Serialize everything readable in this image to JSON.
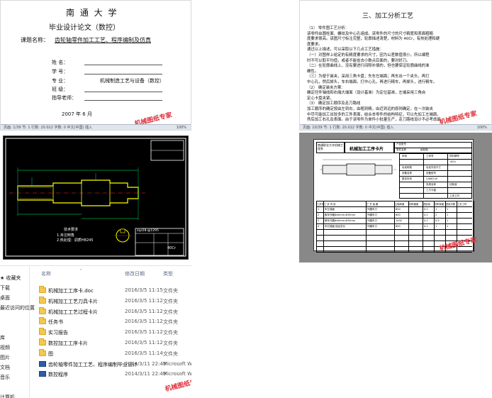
{
  "thesis_cover": {
    "university": "南 通 大 学",
    "subtitle": "毕业设计论文（数控）",
    "topic_label": "课题名称：",
    "topic_value": "齿轮轴零件加工工艺、程序编制及仿真",
    "fields": [
      {
        "label": "姓      名：",
        "value": ""
      },
      {
        "label": "学      号：",
        "value": ""
      },
      {
        "label": "专      业：",
        "value": "机械制造工艺与设备（数控）"
      },
      {
        "label": "班      级：",
        "value": ""
      },
      {
        "label": "指导老师：",
        "value": ""
      }
    ],
    "date": "2007 年 6 月",
    "stamp": "机械图纸专家",
    "status": "页面: 1/39    节: 1    行数: 20.022    字数: 0    中文(中国)    插入",
    "zoom": "100%"
  },
  "analysis_doc": {
    "heading": "三、加工分析工艺",
    "lines": [
      "（1）  零件图工艺分析：",
      "该零件由圆柱面、螺纹及中心孔组成。该零件的尺寸的尺寸精度和表面粗糙",
      "度要求很高。该图尺寸标注完整，轮廓描述清楚，材料为 40Cr，有热处理和硬",
      "度要求。",
      "通过以上描述，可以采取以下几点工艺措施：",
      "（一）对图样上给定的有精度要求的尺寸，因为公差数值很小，所以编程",
      "时不可以取平均值，或者不能省去小数点后面的，要对好刀。",
      "（二）在轮廓曲线上，没有要进行间隙补偿的，但也要保证轮廓曲线的准",
      "确性。",
      "（三）为便于装夹，采用三角卡盘；先车左端面；再车出一个夹头，再打",
      "中心孔，然后掉头，车右端面，打中心孔，再进行精车，再掉头，进行精车。",
      "（2）  确定装夹方案：",
      "确定坯件轴线和右端大端面（设计基准）为定位基准，左端采用三角自",
      "定心卡盘夹紧。",
      "（3）  确定加工顺序及走刀路线",
      "加工顺序的确定按由左到右，由粗到精，由近到远的原则确定。在一次装夹",
      "中尽可能加工出较多的工件表面，结合本零件的结构特征，可以先加工左端面，",
      "然后加工右孔及表面。由于该零件为单件小批量生产，走刀路线设计不必考虑最"
    ],
    "stamp": "机械图纸专家",
    "status": "页面: 10/39    节: 1    行数: 20.022    字数: 0    中文(中国)    插入",
    "zoom": "100%"
  },
  "cad_drawing": {
    "tech_req_title": "技术要求",
    "tech_req_lines": [
      "1.未注倒角",
      "2.热处理：调质HB245"
    ],
    "title_block_top": "zqz28-@1295",
    "material": "40Cr"
  },
  "process_card": {
    "school": "南通职业大学机械工程系",
    "card_title": "机械加工工序卡片",
    "fields": [
      "产品型号",
      "产品名称",
      "零件图号",
      "零件名称",
      "车间",
      "工序号",
      "工序名称",
      "材料牌号",
      "毛坯种类",
      "毛坯外形尺寸",
      "每毛坯可制件数",
      "每台件数",
      "设备名称",
      "设备型号",
      "设备编号",
      "同时加工件数",
      "夹具编号",
      "夹具名称",
      "切削液",
      "工位器具编号",
      "工位器具名称",
      "工序工时"
    ],
    "values": [
      "齿轮轴",
      "40Cr",
      "CAK6140",
      "数控车床",
      "三爪卡盘"
    ],
    "table_headers": [
      "工步号",
      "工 步 内 容",
      "工 艺 装 备",
      "主轴转速",
      "切削速度",
      "进给量",
      "切削深度",
      "进给次数",
      "工步工时"
    ],
    "steps": [
      [
        "1",
        "车左端面",
        "外圆车刀",
        "800",
        "",
        "0.1",
        "1",
        "1",
        ""
      ],
      [
        "2",
        "粗车外圆Φ40mm,Φ30mm",
        "外圆车刀",
        "600",
        "",
        "0.2",
        "2",
        "1",
        ""
      ],
      [
        "3",
        "精车外圆Φ40mm,Φ30mm",
        "外圆车刀",
        "1000",
        "",
        "0.1",
        "0.5",
        "1",
        ""
      ],
      [
        "4",
        "车右端面,保证总长",
        "外圆车刀",
        "800",
        "",
        "0.1",
        "1",
        "1",
        ""
      ]
    ],
    "stamp": "机械图纸专家"
  },
  "file_explorer": {
    "nav_items": [
      "★ 收藏夹",
      "下载",
      "桌面",
      "最近访问的位置",
      "",
      "",
      "库",
      "视频",
      "图片",
      "文档",
      "音乐",
      "",
      "计算机"
    ],
    "columns": {
      "name": "名称",
      "date": "修改日期",
      "type": "类型"
    },
    "files": [
      {
        "name": "机械加工工序卡.doc",
        "date": "2016/3/5 11:15",
        "type": "文件夹",
        "icon": "folder"
      },
      {
        "name": "机械加工工艺刀具卡片",
        "date": "2016/3/5 11:12",
        "type": "文件夹",
        "icon": "folder"
      },
      {
        "name": "机械加工工艺过程卡片",
        "date": "2016/3/5 11:12",
        "type": "文件夹",
        "icon": "folder"
      },
      {
        "name": "任务书",
        "date": "2016/3/5 11:12",
        "type": "文件夹",
        "icon": "folder"
      },
      {
        "name": "实习报告",
        "date": "2016/3/5 11:12",
        "type": "文件夹",
        "icon": "folder"
      },
      {
        "name": "数控加工工序卡片",
        "date": "2016/3/5 11:12",
        "type": "文件夹",
        "icon": "folder"
      },
      {
        "name": "图",
        "date": "2016/3/5 11:14",
        "type": "文件夹",
        "icon": "folder"
      },
      {
        "name": "齿轮轴零件加工工艺、程序编制毕业设计",
        "date": "2014/3/11 22:49",
        "type": "Microsoft Wor",
        "icon": "word"
      },
      {
        "name": "数控程序",
        "date": "2014/3/11 22:49",
        "type": "Microsoft Wor",
        "icon": "word"
      }
    ],
    "stamp": "机械图纸专家"
  }
}
